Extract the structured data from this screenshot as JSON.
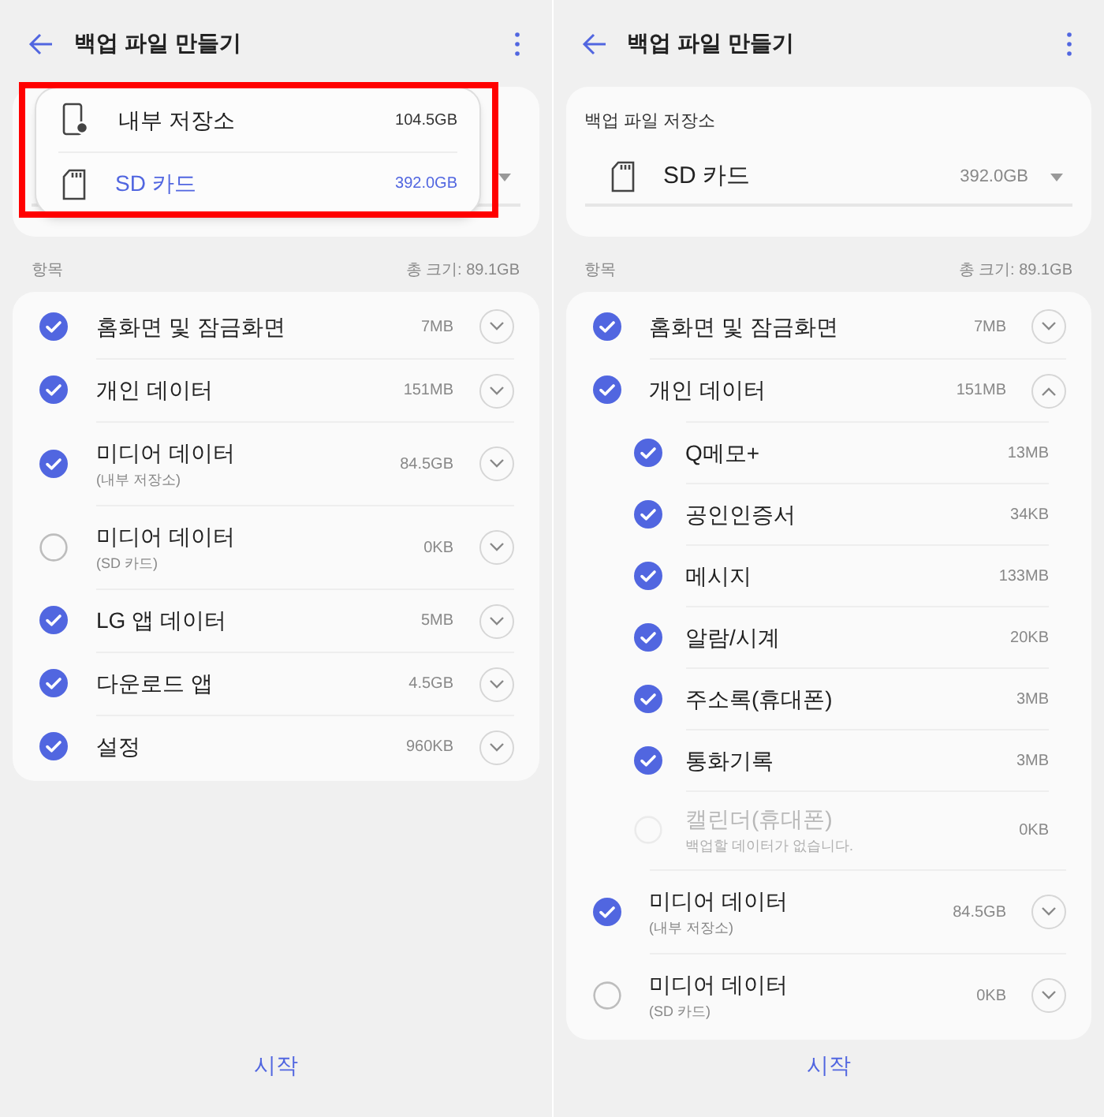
{
  "screens": [
    {
      "title": "백업 파일 만들기",
      "highlighted": true,
      "storage": {
        "menu": [
          {
            "label": "내부 저장소",
            "size": "104.5GB",
            "kind": "phone",
            "selected": false
          },
          {
            "label": "SD 카드",
            "size": "392.0GB",
            "kind": "sd",
            "selected": true
          }
        ]
      },
      "items_label": "항목",
      "total": "총 크기: 89.1GB",
      "items": [
        {
          "name": "홈화면 및 잠금화면",
          "size": "7MB",
          "checked": true,
          "expanded": false
        },
        {
          "name": "개인 데이터",
          "size": "151MB",
          "checked": true,
          "expanded": false
        },
        {
          "name": "미디어 데이터",
          "sub": "(내부 저장소)",
          "size": "84.5GB",
          "checked": true,
          "expanded": false
        },
        {
          "name": "미디어 데이터",
          "sub": "(SD 카드)",
          "size": "0KB",
          "checked": false,
          "expanded": false
        },
        {
          "name": "LG 앱 데이터",
          "size": "5MB",
          "checked": true,
          "expanded": false
        },
        {
          "name": "다운로드 앱",
          "size": "4.5GB",
          "checked": true,
          "expanded": false
        },
        {
          "name": "설정",
          "size": "960KB",
          "checked": true,
          "expanded": false
        }
      ],
      "start_button": "시작"
    },
    {
      "title": "백업 파일 만들기",
      "storage": {
        "label": "백업 파일 저장소",
        "value": "SD 카드",
        "size": "392.0GB",
        "kind": "sd"
      },
      "items_label": "항목",
      "total": "총 크기: 89.1GB",
      "items": [
        {
          "name": "홈화면 및 잠금화면",
          "size": "7MB",
          "checked": true,
          "expanded": false
        },
        {
          "name": "개인 데이터",
          "size": "151MB",
          "checked": true,
          "expanded": true,
          "children": [
            {
              "name": "Q메모+",
              "size": "13MB",
              "checked": true,
              "disabled": false
            },
            {
              "name": "공인인증서",
              "size": "34KB",
              "checked": true,
              "disabled": false
            },
            {
              "name": "메시지",
              "size": "133MB",
              "checked": true,
              "disabled": false
            },
            {
              "name": "알람/시계",
              "size": "20KB",
              "checked": true,
              "disabled": false
            },
            {
              "name": "주소록(휴대폰)",
              "size": "3MB",
              "checked": true,
              "disabled": false
            },
            {
              "name": "통화기록",
              "size": "3MB",
              "checked": true,
              "disabled": false
            },
            {
              "name": "캘린더(휴대폰)",
              "sub": "백업할 데이터가 없습니다.",
              "size": "0KB",
              "checked": false,
              "disabled": true
            }
          ]
        },
        {
          "name": "미디어 데이터",
          "sub": "(내부 저장소)",
          "size": "84.5GB",
          "checked": true,
          "expanded": false
        },
        {
          "name": "미디어 데이터",
          "sub": "(SD 카드)",
          "size": "0KB",
          "checked": false,
          "expanded": false
        }
      ],
      "start_button": "시작"
    }
  ]
}
